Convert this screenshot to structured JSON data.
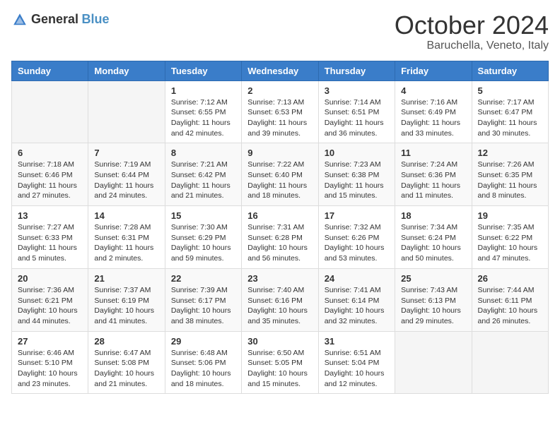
{
  "header": {
    "logo": {
      "general": "General",
      "blue": "Blue"
    },
    "title": "October 2024",
    "subtitle": "Baruchella, Veneto, Italy"
  },
  "weekdays": [
    "Sunday",
    "Monday",
    "Tuesday",
    "Wednesday",
    "Thursday",
    "Friday",
    "Saturday"
  ],
  "weeks": [
    [
      {
        "day": "",
        "info": ""
      },
      {
        "day": "",
        "info": ""
      },
      {
        "day": "1",
        "info": "Sunrise: 7:12 AM\nSunset: 6:55 PM\nDaylight: 11 hours and 42 minutes."
      },
      {
        "day": "2",
        "info": "Sunrise: 7:13 AM\nSunset: 6:53 PM\nDaylight: 11 hours and 39 minutes."
      },
      {
        "day": "3",
        "info": "Sunrise: 7:14 AM\nSunset: 6:51 PM\nDaylight: 11 hours and 36 minutes."
      },
      {
        "day": "4",
        "info": "Sunrise: 7:16 AM\nSunset: 6:49 PM\nDaylight: 11 hours and 33 minutes."
      },
      {
        "day": "5",
        "info": "Sunrise: 7:17 AM\nSunset: 6:47 PM\nDaylight: 11 hours and 30 minutes."
      }
    ],
    [
      {
        "day": "6",
        "info": "Sunrise: 7:18 AM\nSunset: 6:46 PM\nDaylight: 11 hours and 27 minutes."
      },
      {
        "day": "7",
        "info": "Sunrise: 7:19 AM\nSunset: 6:44 PM\nDaylight: 11 hours and 24 minutes."
      },
      {
        "day": "8",
        "info": "Sunrise: 7:21 AM\nSunset: 6:42 PM\nDaylight: 11 hours and 21 minutes."
      },
      {
        "day": "9",
        "info": "Sunrise: 7:22 AM\nSunset: 6:40 PM\nDaylight: 11 hours and 18 minutes."
      },
      {
        "day": "10",
        "info": "Sunrise: 7:23 AM\nSunset: 6:38 PM\nDaylight: 11 hours and 15 minutes."
      },
      {
        "day": "11",
        "info": "Sunrise: 7:24 AM\nSunset: 6:36 PM\nDaylight: 11 hours and 11 minutes."
      },
      {
        "day": "12",
        "info": "Sunrise: 7:26 AM\nSunset: 6:35 PM\nDaylight: 11 hours and 8 minutes."
      }
    ],
    [
      {
        "day": "13",
        "info": "Sunrise: 7:27 AM\nSunset: 6:33 PM\nDaylight: 11 hours and 5 minutes."
      },
      {
        "day": "14",
        "info": "Sunrise: 7:28 AM\nSunset: 6:31 PM\nDaylight: 11 hours and 2 minutes."
      },
      {
        "day": "15",
        "info": "Sunrise: 7:30 AM\nSunset: 6:29 PM\nDaylight: 10 hours and 59 minutes."
      },
      {
        "day": "16",
        "info": "Sunrise: 7:31 AM\nSunset: 6:28 PM\nDaylight: 10 hours and 56 minutes."
      },
      {
        "day": "17",
        "info": "Sunrise: 7:32 AM\nSunset: 6:26 PM\nDaylight: 10 hours and 53 minutes."
      },
      {
        "day": "18",
        "info": "Sunrise: 7:34 AM\nSunset: 6:24 PM\nDaylight: 10 hours and 50 minutes."
      },
      {
        "day": "19",
        "info": "Sunrise: 7:35 AM\nSunset: 6:22 PM\nDaylight: 10 hours and 47 minutes."
      }
    ],
    [
      {
        "day": "20",
        "info": "Sunrise: 7:36 AM\nSunset: 6:21 PM\nDaylight: 10 hours and 44 minutes."
      },
      {
        "day": "21",
        "info": "Sunrise: 7:37 AM\nSunset: 6:19 PM\nDaylight: 10 hours and 41 minutes."
      },
      {
        "day": "22",
        "info": "Sunrise: 7:39 AM\nSunset: 6:17 PM\nDaylight: 10 hours and 38 minutes."
      },
      {
        "day": "23",
        "info": "Sunrise: 7:40 AM\nSunset: 6:16 PM\nDaylight: 10 hours and 35 minutes."
      },
      {
        "day": "24",
        "info": "Sunrise: 7:41 AM\nSunset: 6:14 PM\nDaylight: 10 hours and 32 minutes."
      },
      {
        "day": "25",
        "info": "Sunrise: 7:43 AM\nSunset: 6:13 PM\nDaylight: 10 hours and 29 minutes."
      },
      {
        "day": "26",
        "info": "Sunrise: 7:44 AM\nSunset: 6:11 PM\nDaylight: 10 hours and 26 minutes."
      }
    ],
    [
      {
        "day": "27",
        "info": "Sunrise: 6:46 AM\nSunset: 5:10 PM\nDaylight: 10 hours and 23 minutes."
      },
      {
        "day": "28",
        "info": "Sunrise: 6:47 AM\nSunset: 5:08 PM\nDaylight: 10 hours and 21 minutes."
      },
      {
        "day": "29",
        "info": "Sunrise: 6:48 AM\nSunset: 5:06 PM\nDaylight: 10 hours and 18 minutes."
      },
      {
        "day": "30",
        "info": "Sunrise: 6:50 AM\nSunset: 5:05 PM\nDaylight: 10 hours and 15 minutes."
      },
      {
        "day": "31",
        "info": "Sunrise: 6:51 AM\nSunset: 5:04 PM\nDaylight: 10 hours and 12 minutes."
      },
      {
        "day": "",
        "info": ""
      },
      {
        "day": "",
        "info": ""
      }
    ]
  ]
}
